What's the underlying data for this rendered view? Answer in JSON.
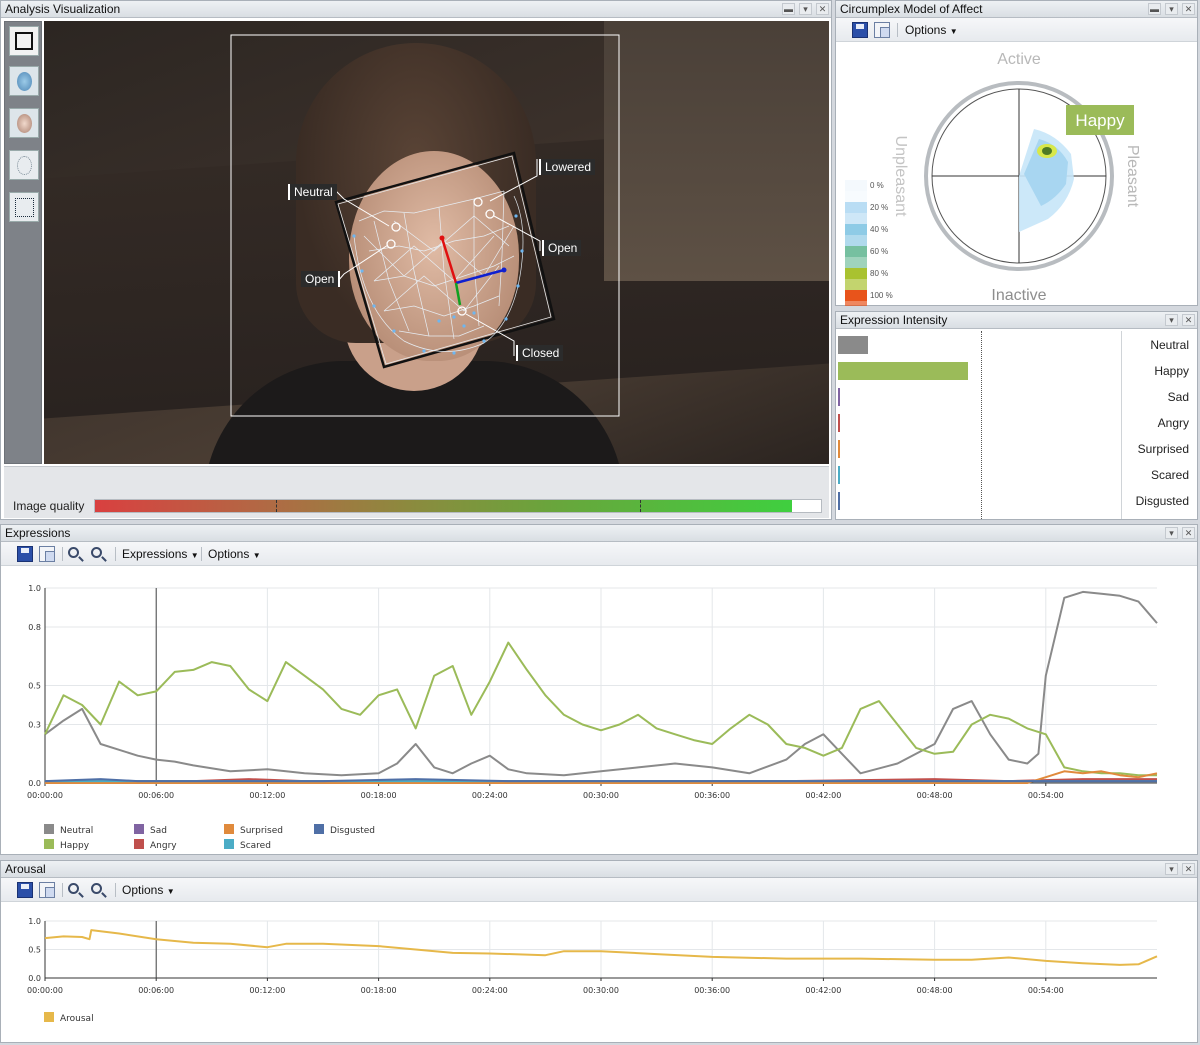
{
  "analysis": {
    "title": "Analysis Visualization",
    "side_tools": [
      "frame-tool-icon",
      "mesh-face-icon",
      "face-icon",
      "dotted-face-icon",
      "landmarks-icon"
    ],
    "annotations": {
      "neutral": "Neutral",
      "lowered": "Lowered",
      "open_left": "Open",
      "open_right": "Open",
      "closed": "Closed"
    },
    "image_quality_label": "Image quality",
    "image_quality": 0.96
  },
  "circumplex": {
    "title": "Circumplex Model of Affect",
    "options_label": "Options",
    "active": "Active",
    "inactive": "Inactive",
    "pleasant": "Pleasant",
    "unpleasant": "Unpleasant",
    "highlight": "Happy",
    "scale": [
      {
        "label": "0 %",
        "color": "#f4f9fd"
      },
      {
        "label": "20 %",
        "color": "#b9ddf4"
      },
      {
        "label": "40 %",
        "color": "#8ecbe6"
      },
      {
        "label": "60 %",
        "color": "#76c0a0"
      },
      {
        "label": "80 %",
        "color": "#a9c230"
      },
      {
        "label": "100 %",
        "color": "#e8541b"
      }
    ]
  },
  "intensity": {
    "title": "Expression Intensity",
    "items": [
      {
        "label": "Neutral",
        "value": 0.22,
        "color": "#8a8a8a"
      },
      {
        "label": "Happy",
        "value": 0.95,
        "color": "#9bbb59"
      },
      {
        "label": "Sad",
        "value": 0.0,
        "color": "#8064a2"
      },
      {
        "label": "Angry",
        "value": 0.01,
        "color": "#c0504d"
      },
      {
        "label": "Surprised",
        "value": 0.0,
        "color": "#e08a3c"
      },
      {
        "label": "Scared",
        "value": 0.01,
        "color": "#4bacc6"
      },
      {
        "label": "Disgusted",
        "value": 0.01,
        "color": "#4f6fa6"
      }
    ]
  },
  "expressions": {
    "title": "Expressions",
    "menu_label": "Expressions",
    "options_label": "Options",
    "chart_data": {
      "type": "line",
      "y_ticks": [
        "1.0",
        "0.8",
        "0.5",
        "0.3",
        "0.0"
      ],
      "x_ticks": [
        "00:00:00",
        "00:06:00",
        "00:12:00",
        "00:18:00",
        "00:24:00",
        "00:30:00",
        "00:36:00",
        "00:42:00",
        "00:48:00",
        "00:54:00"
      ],
      "ylim": [
        0,
        1
      ],
      "xlim_min": [
        0,
        60
      ],
      "cursor_min": 6,
      "grid": true,
      "series": [
        {
          "name": "Neutral",
          "color": "#8a8a8a",
          "x": [
            0,
            1,
            2,
            3,
            4,
            5,
            6,
            7,
            8,
            10,
            12,
            14,
            16,
            18,
            19,
            20,
            21,
            22,
            23,
            24,
            25,
            26,
            28,
            30,
            32,
            34,
            36,
            38,
            40,
            41,
            42,
            43,
            44,
            46,
            48,
            49,
            50,
            51,
            52,
            53,
            53.6,
            54,
            55,
            56,
            57,
            58,
            59,
            60
          ],
          "values": [
            0.25,
            0.32,
            0.38,
            0.2,
            0.17,
            0.14,
            0.12,
            0.11,
            0.09,
            0.06,
            0.07,
            0.05,
            0.04,
            0.05,
            0.1,
            0.2,
            0.08,
            0.05,
            0.1,
            0.14,
            0.07,
            0.05,
            0.04,
            0.06,
            0.08,
            0.1,
            0.08,
            0.05,
            0.12,
            0.2,
            0.25,
            0.15,
            0.05,
            0.1,
            0.2,
            0.38,
            0.42,
            0.25,
            0.12,
            0.1,
            0.15,
            0.55,
            0.95,
            0.98,
            0.97,
            0.96,
            0.93,
            0.82
          ]
        },
        {
          "name": "Happy",
          "color": "#9bbb59",
          "x": [
            0,
            1,
            2,
            3,
            4,
            5,
            6,
            7,
            8,
            9,
            10,
            11,
            12,
            13,
            14,
            15,
            16,
            17,
            18,
            19,
            20,
            21,
            22,
            23,
            24,
            25,
            26,
            27,
            28,
            29,
            30,
            31,
            32,
            33,
            34,
            35,
            36,
            37,
            38,
            39,
            40,
            41,
            42,
            43,
            44,
            45,
            46,
            47,
            48,
            49,
            50,
            51,
            52,
            53,
            54,
            55,
            56,
            57,
            58,
            59,
            60
          ],
          "values": [
            0.25,
            0.45,
            0.4,
            0.3,
            0.52,
            0.45,
            0.47,
            0.57,
            0.58,
            0.62,
            0.6,
            0.48,
            0.42,
            0.62,
            0.55,
            0.48,
            0.38,
            0.35,
            0.45,
            0.48,
            0.28,
            0.55,
            0.6,
            0.35,
            0.52,
            0.72,
            0.58,
            0.45,
            0.35,
            0.3,
            0.27,
            0.3,
            0.35,
            0.28,
            0.25,
            0.22,
            0.2,
            0.28,
            0.35,
            0.3,
            0.2,
            0.18,
            0.14,
            0.18,
            0.38,
            0.42,
            0.3,
            0.18,
            0.15,
            0.16,
            0.3,
            0.35,
            0.33,
            0.28,
            0.25,
            0.08,
            0.06,
            0.05,
            0.05,
            0.04,
            0.04
          ]
        },
        {
          "name": "Sad",
          "color": "#8064a2",
          "x": [
            0,
            10,
            20,
            30,
            40,
            50,
            60
          ],
          "values": [
            0.01,
            0.01,
            0.01,
            0.01,
            0.01,
            0.01,
            0.01
          ]
        },
        {
          "name": "Angry",
          "color": "#c0504d",
          "x": [
            0,
            8,
            11,
            14,
            20,
            30,
            40,
            48,
            52,
            56,
            60
          ],
          "values": [
            0.01,
            0.01,
            0.02,
            0.01,
            0.01,
            0.01,
            0.01,
            0.02,
            0.01,
            0.02,
            0.02
          ]
        },
        {
          "name": "Surprised",
          "color": "#e08a3c",
          "x": [
            0,
            30,
            53,
            54,
            55,
            56,
            57,
            58,
            59,
            60
          ],
          "values": [
            0.0,
            0.0,
            0.0,
            0.03,
            0.06,
            0.05,
            0.06,
            0.04,
            0.03,
            0.05
          ]
        },
        {
          "name": "Scared",
          "color": "#4bacc6",
          "x": [
            0,
            20,
            40,
            60
          ],
          "values": [
            0.01,
            0.01,
            0.01,
            0.01
          ]
        },
        {
          "name": "Disgusted",
          "color": "#4f6fa6",
          "x": [
            0,
            3,
            5,
            10,
            15,
            20,
            25,
            30,
            35,
            40,
            45,
            50,
            55,
            60
          ],
          "values": [
            0.01,
            0.02,
            0.01,
            0.01,
            0.01,
            0.02,
            0.01,
            0.01,
            0.01,
            0.01,
            0.01,
            0.01,
            0.01,
            0.01
          ]
        }
      ]
    }
  },
  "arousal": {
    "title": "Arousal",
    "options_label": "Options",
    "chart_data": {
      "type": "line",
      "y_ticks": [
        "1.0",
        "0.5",
        "0.0"
      ],
      "x_ticks": [
        "00:00:00",
        "00:06:00",
        "00:12:00",
        "00:18:00",
        "00:24:00",
        "00:30:00",
        "00:36:00",
        "00:42:00",
        "00:48:00",
        "00:54:00"
      ],
      "ylim": [
        0,
        1
      ],
      "xlim_min": [
        0,
        60
      ],
      "cursor_min": 6,
      "grid": true,
      "series": [
        {
          "name": "Arousal",
          "color": "#e6b84a",
          "x": [
            0,
            1,
            2,
            2.4,
            2.5,
            4,
            6,
            8,
            10,
            12,
            13,
            15,
            18,
            20,
            22,
            24,
            27,
            28,
            30,
            33,
            36,
            40,
            44,
            48,
            50,
            52,
            54,
            56,
            58,
            59,
            60
          ],
          "values": [
            0.7,
            0.73,
            0.72,
            0.68,
            0.84,
            0.78,
            0.68,
            0.62,
            0.6,
            0.54,
            0.6,
            0.6,
            0.56,
            0.5,
            0.44,
            0.43,
            0.4,
            0.47,
            0.47,
            0.42,
            0.37,
            0.34,
            0.34,
            0.32,
            0.32,
            0.36,
            0.3,
            0.26,
            0.23,
            0.24,
            0.38
          ]
        }
      ]
    }
  }
}
